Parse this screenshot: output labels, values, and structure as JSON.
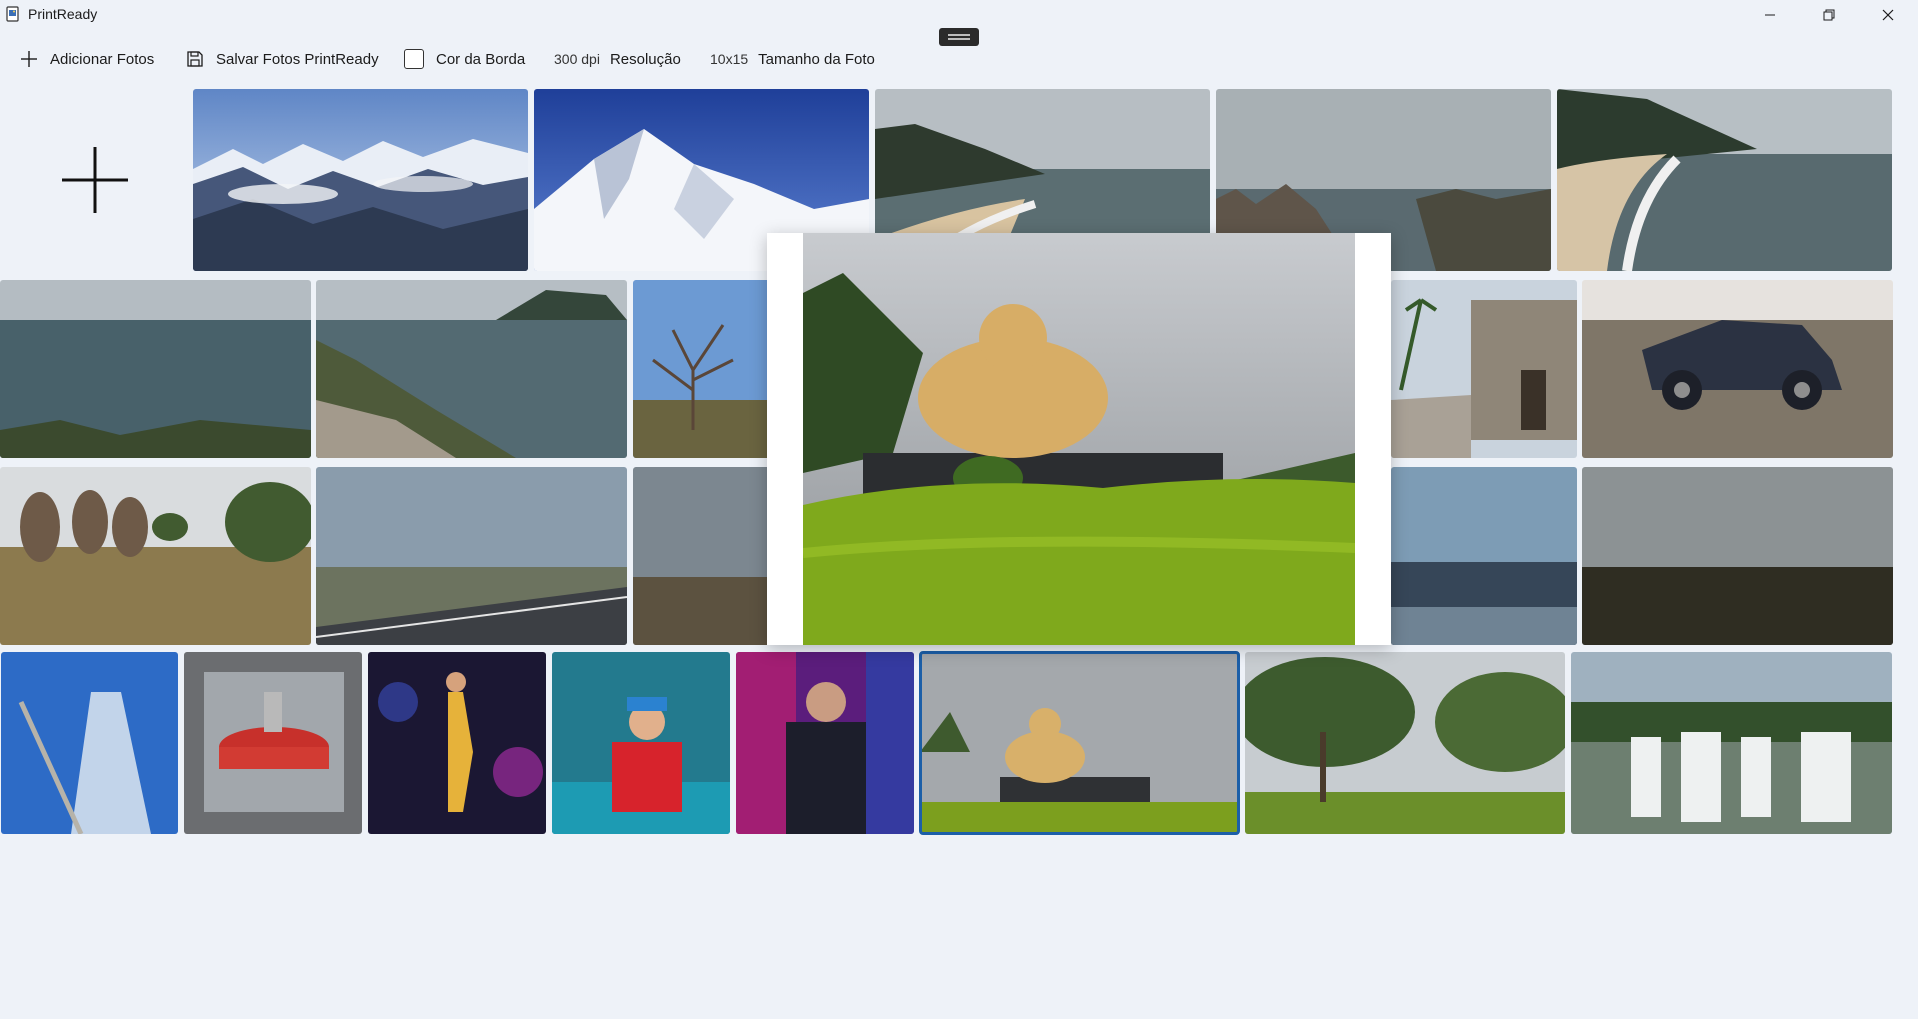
{
  "app": {
    "title": "PrintReady"
  },
  "toolbar": {
    "add_label": "Adicionar Fotos",
    "save_label": "Salvar Fotos PrintReady",
    "border_label": "Cor da Borda",
    "resolution_value": "300 dpi",
    "resolution_label": "Resolução",
    "size_value": "10x15",
    "size_label": "Tamanho da Foto"
  },
  "icons": {
    "add": "plus-icon",
    "save": "floppy-disk-icon",
    "border": "checkbox-icon",
    "minimize": "minimize-icon",
    "maximize": "restore-icon",
    "close": "close-icon"
  },
  "colors": {
    "background": "#eef2f8",
    "selection": "#1c5fa8"
  }
}
